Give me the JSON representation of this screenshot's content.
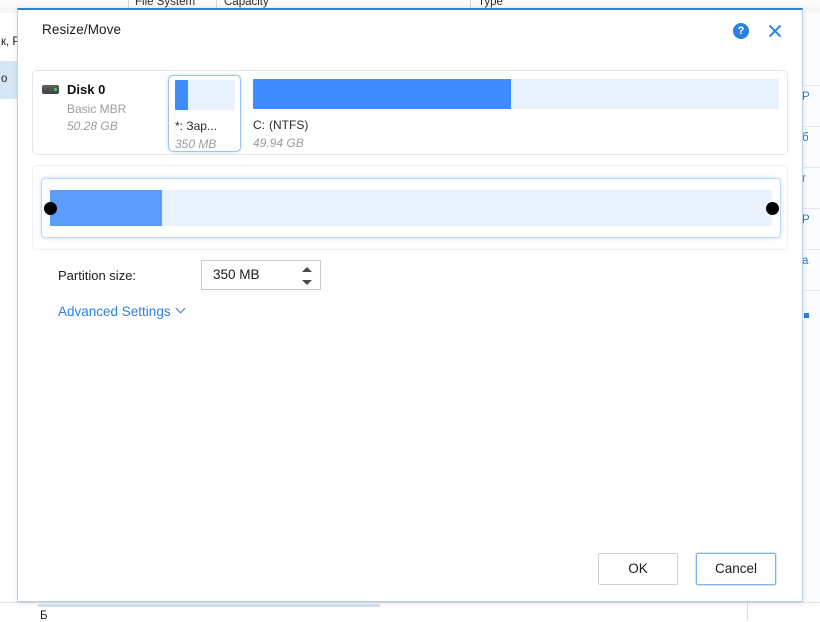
{
  "background": {
    "table_headers": [
      "File System",
      "Capacity",
      "Type"
    ],
    "left_fragments": [
      "к, Р",
      "о"
    ],
    "right_menu_fragments": [
      "Р",
      "б",
      "г",
      "P",
      "а"
    ],
    "bottom_fragment": "Б"
  },
  "dialog": {
    "title": "Resize/Move",
    "help_icon_label": "?",
    "help_icon_name": "help-circle-icon",
    "close_icon_name": "close-icon",
    "accent_color": "#2a81e0",
    "disk": {
      "name": "Disk 0",
      "scheme": "Basic MBR",
      "capacity": "50.28 GB",
      "icon_name": "hard-disk-icon",
      "partitions": [
        {
          "label": "*: Зар...",
          "filesystem": "",
          "size": "350 MB",
          "selected": true,
          "used_percent": 22
        },
        {
          "label": "C:",
          "filesystem": "(NTFS)",
          "size": "49.94 GB",
          "selected": false,
          "used_percent": 49
        }
      ]
    },
    "slider": {
      "fill_percent": 15.5,
      "left_handle_percent": 0,
      "right_handle_percent": 100,
      "fill_color": "#5c9cfb",
      "track_color": "#e8f1fc"
    },
    "form": {
      "partition_size_label": "Partition size:",
      "partition_size_value": "350 MB",
      "advanced_settings_label": "Advanced Settings"
    },
    "footer": {
      "ok_label": "OK",
      "cancel_label": "Cancel"
    }
  }
}
